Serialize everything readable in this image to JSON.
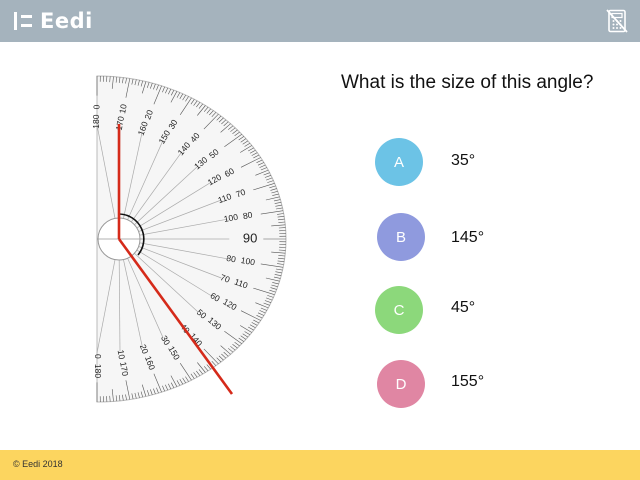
{
  "header": {
    "brand": "Eedi",
    "logo_icon": "eedi-logo-icon",
    "calculator_icon": "no-calculator-icon"
  },
  "question": {
    "text": "What is the size of this angle?"
  },
  "options": [
    {
      "letter": "A",
      "answer": "35°",
      "color": "#6cc3e6"
    },
    {
      "letter": "B",
      "answer": "145°",
      "color": "#8f9ade"
    },
    {
      "letter": "C",
      "answer": "45°",
      "color": "#8cd87b"
    },
    {
      "letter": "D",
      "answer": "155°",
      "color": "#e086a3"
    }
  ],
  "protractor": {
    "outer_labels": [
      "0",
      "10",
      "20",
      "30",
      "40",
      "50",
      "60",
      "70",
      "80",
      "90",
      "100",
      "110",
      "120",
      "130",
      "140",
      "150",
      "160",
      "170",
      "180"
    ],
    "inner_labels": [
      "180",
      "170",
      "160",
      "150",
      "140",
      "130",
      "120",
      "110",
      "100",
      "90",
      "80",
      "70",
      "60",
      "50",
      "40",
      "30",
      "20",
      "10",
      "0"
    ],
    "angle_line_color": "#d52a1a"
  },
  "footer": {
    "copyright": "© Eedi 2018"
  },
  "colors": {
    "header_bg": "#a5b3bd",
    "footer_bg": "#fcd55f"
  }
}
